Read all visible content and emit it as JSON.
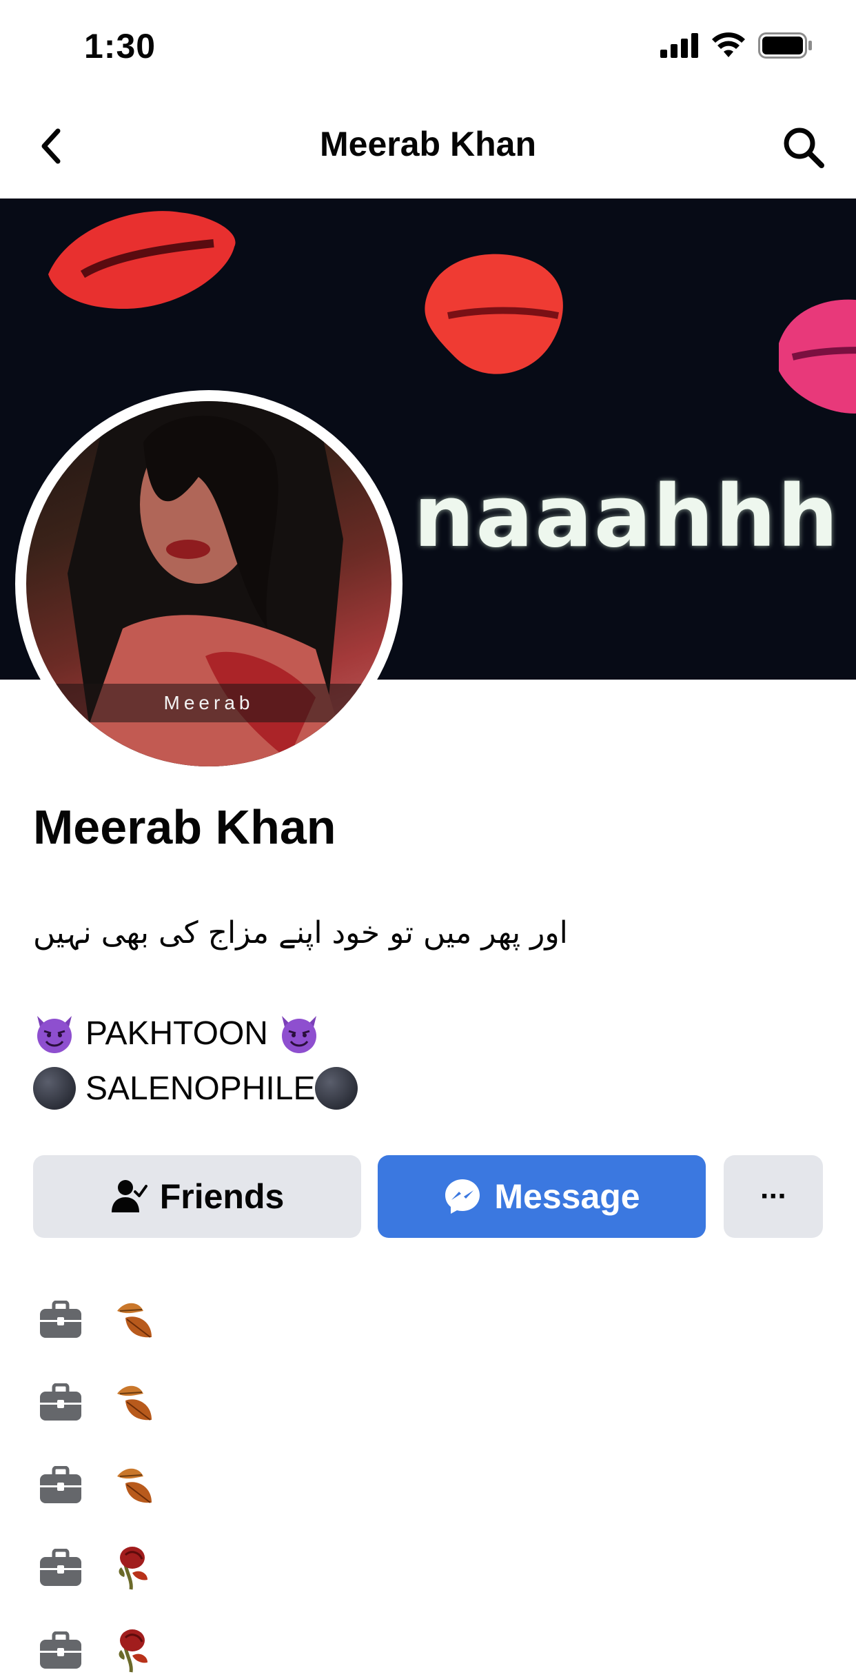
{
  "status_bar": {
    "time": "1:30",
    "signal_icon": "cellular-signal-icon",
    "wifi_icon": "wifi-icon",
    "battery_icon": "battery-icon"
  },
  "nav": {
    "title": "Meerab Khan",
    "back_icon": "chevron-left-icon",
    "search_icon": "search-icon"
  },
  "cover": {
    "text": "naaahhh",
    "image": "cover-photo"
  },
  "avatar": {
    "caption": "Meerab",
    "image": "profile-picture"
  },
  "profile": {
    "name": "Meerab Khan",
    "bio_urdu": "اور پھر میں تو خود اپنے مزاج کی بھی نہیں",
    "bio_line_1": "PAKHTOON",
    "bio_line_2": "SALENOPHILE"
  },
  "actions": {
    "friends_label": "Friends",
    "friends_icon": "person-check-icon",
    "message_label": "Message",
    "message_icon": "messenger-icon",
    "more_label": "···",
    "more_icon": "more-dots-icon"
  },
  "details": [
    {
      "icon": "briefcase-icon",
      "emoji": "fallen-leaf-emoji"
    },
    {
      "icon": "briefcase-icon",
      "emoji": "fallen-leaf-emoji"
    },
    {
      "icon": "briefcase-icon",
      "emoji": "fallen-leaf-emoji"
    },
    {
      "icon": "briefcase-icon",
      "emoji": "wilted-rose-emoji"
    },
    {
      "icon": "briefcase-icon",
      "emoji": "wilted-rose-emoji"
    }
  ],
  "colors": {
    "accent": "#3b78e0",
    "button_gray": "#e4e6eb",
    "text": "#050505"
  }
}
